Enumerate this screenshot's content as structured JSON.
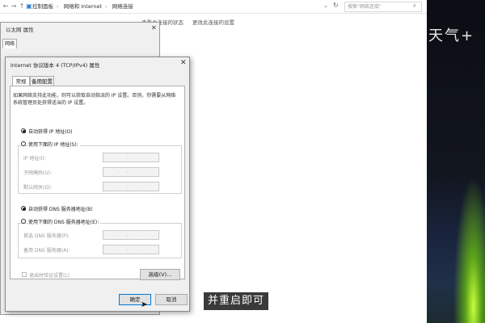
{
  "explorer": {
    "breadcrumb": [
      "控制面板",
      "网络和 Internet",
      "网络连接"
    ],
    "search_placeholder": "搜索\"网络连接\"",
    "commands": [
      "查看此连接的状态",
      "更改此连接的设置"
    ]
  },
  "wallpaper_text": "天气+",
  "ethernet_dialog": {
    "title": "以太网 属性",
    "tab": "网络"
  },
  "ipv4_dialog": {
    "title": "Internet 协议版本 4 (TCP/IPv4) 属性",
    "tabs": [
      "常规",
      "备用配置"
    ],
    "description": "如果网络支持此功能，则可以获取自动指派的 IP 设置。否则，你需要从网络系统管理员处获得适当的 IP 设置。",
    "ip_auto": "自动获得 IP 地址(O)",
    "ip_manual": "使用下面的 IP 地址(S):",
    "ip_auto_selected": true,
    "ip_fields": [
      {
        "label": "IP 地址(I):",
        "value": "..."
      },
      {
        "label": "子网掩码(U):",
        "value": "..."
      },
      {
        "label": "默认网关(D):",
        "value": "..."
      }
    ],
    "dns_auto": "自动获得 DNS 服务器地址(B)",
    "dns_manual": "使用下面的 DNS 服务器地址(E):",
    "dns_auto_selected": true,
    "dns_fields": [
      {
        "label": "首选 DNS 服务器(P):",
        "value": "..."
      },
      {
        "label": "备用 DNS 服务器(A):",
        "value": "..."
      }
    ],
    "validate_label": "退出时验证设置(L)",
    "advanced_button": "高级(V)...",
    "ok_button": "确定",
    "cancel_button": "取消"
  },
  "subtitle": "并重启即可"
}
